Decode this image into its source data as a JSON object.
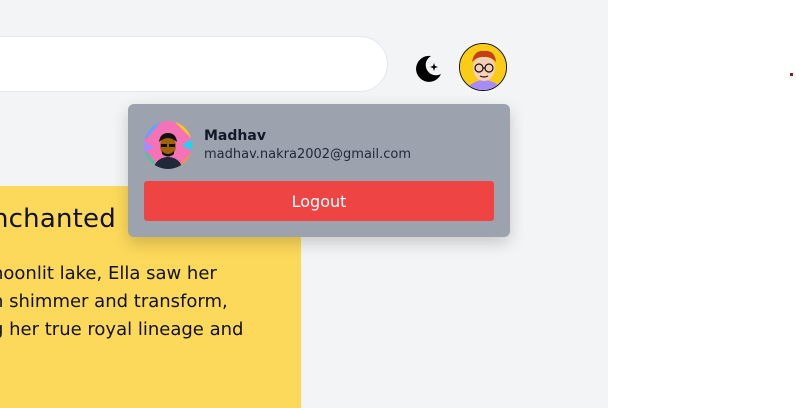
{
  "theme_toggle": {
    "icon": "moon-star-icon"
  },
  "header_avatar": {
    "icon": "cartoon-avatar-icon",
    "bg_color": "#facc15"
  },
  "card": {
    "bg_color": "#fcd95a",
    "title": "nchanted",
    "body_lines": [
      "noonlit lake, Ella saw her",
      "n shimmer and transform,",
      "g her true royal lineage and"
    ]
  },
  "account_dropdown": {
    "bg_color": "#9ca3af",
    "name": "Madhav",
    "email": "madhav.nakra2002@gmail.com",
    "logout_label": "Logout",
    "logout_color": "#ef4444"
  }
}
